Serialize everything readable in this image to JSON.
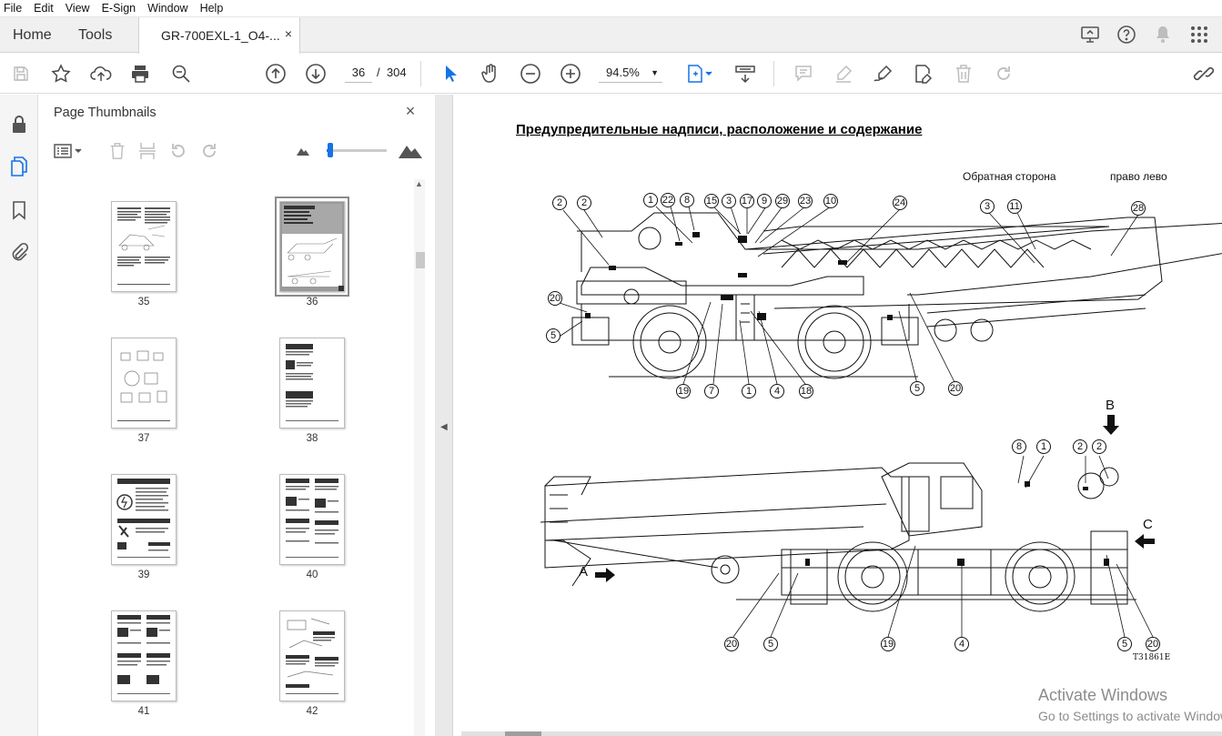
{
  "menu": [
    "File",
    "Edit",
    "View",
    "E-Sign",
    "Window",
    "Help"
  ],
  "tabs": {
    "home": "Home",
    "tools": "Tools",
    "document": "GR-700EXL-1_O4-...",
    "close": "×"
  },
  "toolbar": {
    "page_current": "36",
    "page_sep": "/",
    "page_total": "304",
    "zoom": "94.5%"
  },
  "panel": {
    "title": "Page Thumbnails",
    "close": "×"
  },
  "thumbnails": [
    {
      "label": "35"
    },
    {
      "label": "36",
      "selected": true
    },
    {
      "label": "37"
    },
    {
      "label": "38"
    },
    {
      "label": "39"
    },
    {
      "label": "40"
    },
    {
      "label": "41"
    },
    {
      "label": "42"
    }
  ],
  "document": {
    "title": "Предупредительные надписи, расположение и содержание",
    "reverse_side": "Обратная сторона",
    "right_left": "право  лево",
    "figure_id": "T31861E",
    "view_labels": {
      "a": "A",
      "b": "B",
      "c": "C"
    },
    "callouts_top": [
      "2",
      "2",
      "1",
      "22",
      "8",
      "15",
      "3",
      "17",
      "9",
      "29",
      "23",
      "10",
      "24",
      "3",
      "11",
      "28",
      "20",
      "5",
      "19",
      "7",
      "1",
      "4",
      "18",
      "5",
      "20"
    ],
    "callouts_bottom": [
      "8",
      "1",
      "2",
      "2",
      "20",
      "5",
      "19",
      "4",
      "5",
      "20"
    ]
  },
  "watermark": {
    "line1": "Activate Windows",
    "line2": "Go to Settings to activate Windows."
  }
}
